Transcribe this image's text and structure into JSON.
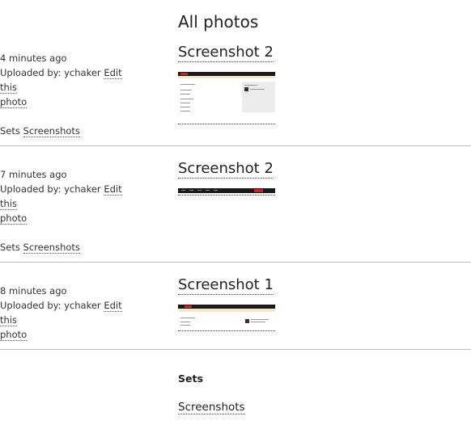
{
  "page": {
    "title": "All photos"
  },
  "photos": [
    {
      "time": "4 minutes ago",
      "uploaded_label": "Uploaded by: ychaker",
      "edit_label_1": "Edit this",
      "edit_label_2": "photo",
      "sets_label": "Sets",
      "set_name": "Screenshots",
      "title": "Screenshot 2"
    },
    {
      "time": "7 minutes ago",
      "uploaded_label": "Uploaded by: ychaker",
      "edit_label_1": "Edit this",
      "edit_label_2": "photo",
      "sets_label": "Sets",
      "set_name": "Screenshots",
      "title": "Screenshot 2"
    },
    {
      "time": "8 minutes ago",
      "uploaded_label": "Uploaded by: ychaker",
      "edit_label_1": "Edit this",
      "edit_label_2": "photo",
      "title": "Screenshot 1"
    }
  ],
  "sets_panel": {
    "heading": "Sets",
    "items": [
      "Screenshots"
    ]
  },
  "colors": {
    "thumb_nav": "#1a1a1a",
    "thumb_accent": "#cc2222",
    "thumb_stripe": "#f2e9c8",
    "separator": "#bbbbbb"
  }
}
